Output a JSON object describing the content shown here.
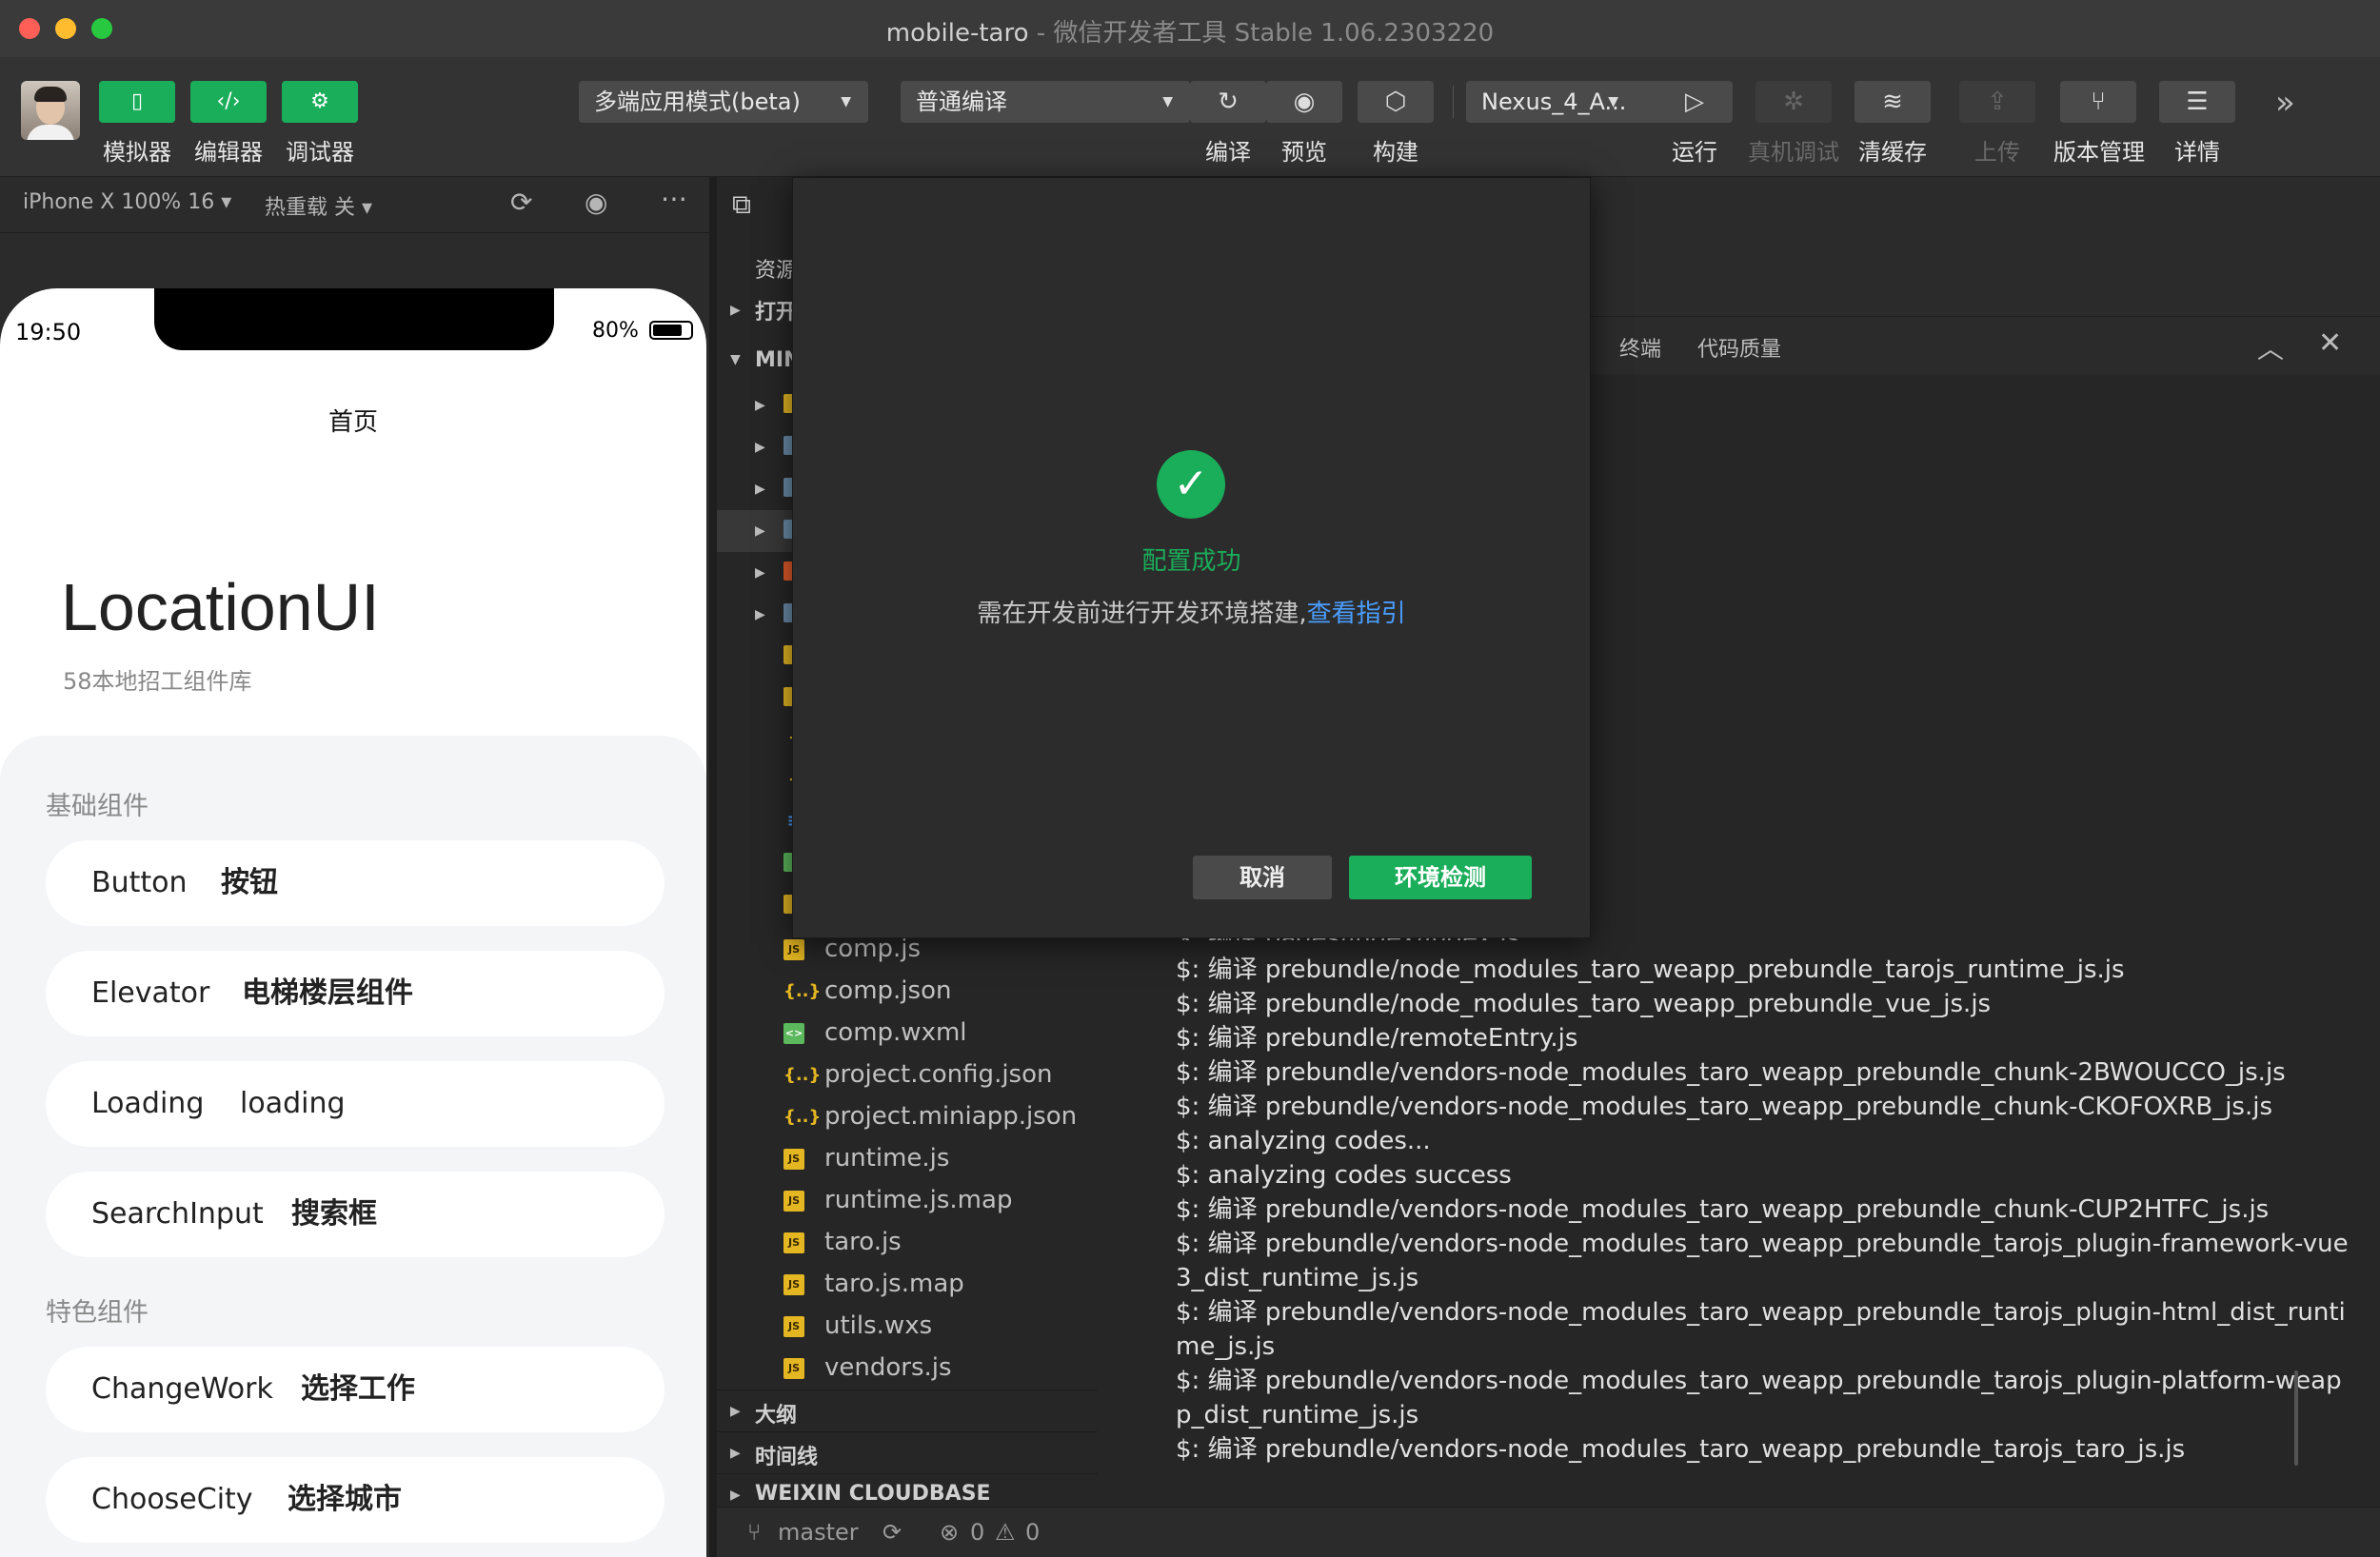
{
  "window": {
    "title": "mobile-taro",
    "subtitle": " - 微信开发者工具 Stable 1.06.2303220"
  },
  "toolbar": {
    "simulator": "模拟器",
    "editor": "编辑器",
    "debugger": "调试器",
    "mode_select": "多端应用模式(beta)",
    "compile_select": "普通编译",
    "compile": "编译",
    "preview": "预览",
    "build": "构建",
    "device_select": "Nexus_4_A...",
    "run": "运行",
    "remote_debug": "真机调试",
    "clear_cache": "清缓存",
    "upload": "上传",
    "version_mgmt": "版本管理",
    "details": "详情"
  },
  "simbar": {
    "device": "iPhone X 100% 16 ▾",
    "hot_reload": "热重载 关 ▾"
  },
  "phone": {
    "time": "19:50",
    "battery": "80%",
    "nav_title": "首页",
    "brand": "LocationUI",
    "brand_sub": "58本地招工组件库",
    "section_basic": "基础组件",
    "section_feature": "特色组件",
    "items": [
      {
        "en": "Button",
        "cn": "按钮"
      },
      {
        "en": "Elevator",
        "cn": "电梯楼层组件"
      },
      {
        "en": "Loading",
        "cn": "loading"
      },
      {
        "en": "SearchInput",
        "cn": "搜索框"
      },
      {
        "en": "ChangeWork",
        "cn": "选择工作"
      },
      {
        "en": "ChooseCity",
        "cn": "选择城市"
      }
    ]
  },
  "explorer": {
    "header": "资源",
    "open_editors": "打开",
    "project": "MIN",
    "files": [
      "comp.js",
      "comp.json",
      "comp.wxml",
      "project.config.json",
      "project.miniapp.json",
      "runtime.js",
      "runtime.js.map",
      "taro.js",
      "taro.js.map",
      "utils.wxs",
      "vendors.js"
    ],
    "outline": "大纲",
    "timeline": "时间线",
    "cloudbase": "WEIXIN CLOUDBASE CONTAI..."
  },
  "console": {
    "tab_terminal": "终端",
    "tab_quality": "代码质量",
    "partial_line": "$: 编译 pages/index/index.js",
    "lines": [
      "$: 编译 prebundle/node_modules_taro_weapp_prebundle_tarojs_runtime_js.js",
      "$: 编译 prebundle/node_modules_taro_weapp_prebundle_vue_js.js",
      "$: 编译 prebundle/remoteEntry.js",
      "$: 编译 prebundle/vendors-node_modules_taro_weapp_prebundle_chunk-2BWOUCCO_js.js",
      "$: 编译 prebundle/vendors-node_modules_taro_weapp_prebundle_chunk-CKOFOXRB_js.js",
      "$: analyzing codes...",
      "$: analyzing codes success",
      "$: 编译 prebundle/vendors-node_modules_taro_weapp_prebundle_chunk-CUP2HTFC_js.js",
      "$: 编译 prebundle/vendors-node_modules_taro_weapp_prebundle_tarojs_plugin-framework-vue3_dist_runtime_js.js",
      "$: 编译 prebundle/vendors-node_modules_taro_weapp_prebundle_tarojs_plugin-html_dist_runtime_js.js",
      "$: 编译 prebundle/vendors-node_modules_taro_weapp_prebundle_tarojs_plugin-platform-weapp_dist_runtime_js.js",
      "$: 编译 prebundle/vendors-node_modules_taro_weapp_prebundle_tarojs_taro_js.js"
    ]
  },
  "statusbar": {
    "branch": "master",
    "errors": "0",
    "warnings": "0"
  },
  "modal": {
    "title": "配置成功",
    "message": "需在开发前进行开发环境搭建,",
    "link": "查看指引",
    "cancel": "取消",
    "check": "环境检测"
  },
  "colors": {
    "accent_green": "#1aad5a",
    "link_blue": "#4a9eff"
  }
}
